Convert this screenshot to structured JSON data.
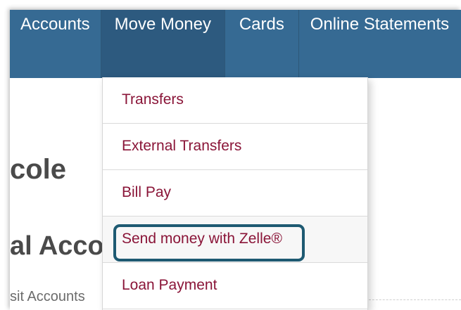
{
  "nav": {
    "items": [
      {
        "label": "Accounts"
      },
      {
        "label": "Move Money",
        "active": true
      },
      {
        "label": "Cards"
      },
      {
        "label": "Online Statements"
      }
    ]
  },
  "page": {
    "heading_partial": "cole",
    "section_partial": "al Acco",
    "subsection_partial": "sit Accounts"
  },
  "dropdown": {
    "items": [
      {
        "label": "Transfers"
      },
      {
        "label": "External Transfers"
      },
      {
        "label": "Bill Pay"
      },
      {
        "label": "Send money with Zelle®",
        "highlighted": true
      },
      {
        "label": "Loan Payment"
      }
    ]
  },
  "colors": {
    "nav_background": "#366a93",
    "nav_active": "#2d5a7f",
    "menu_link": "#8a1538",
    "highlight_border": "#1e5a72"
  }
}
